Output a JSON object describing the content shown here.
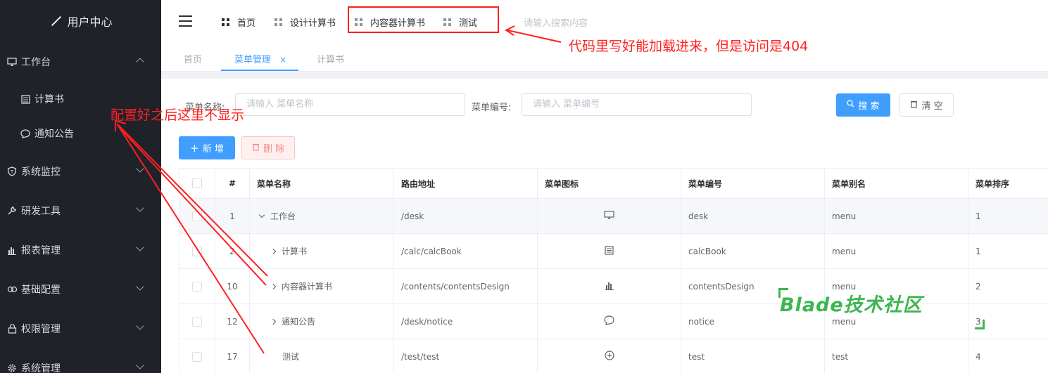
{
  "sidebar": {
    "logo": "用户中心",
    "items": [
      {
        "label": "工作台",
        "icon": "monitor-icon",
        "expanded": true
      },
      {
        "label": "计算书",
        "icon": "calculator-icon",
        "sub": true
      },
      {
        "label": "通知公告",
        "icon": "chat-bubble-icon",
        "sub": true
      },
      {
        "label": "系统监控",
        "icon": "shield-icon"
      },
      {
        "label": "研发工具",
        "icon": "wrench-icon"
      },
      {
        "label": "报表管理",
        "icon": "bar-chart-icon"
      },
      {
        "label": "基础配置",
        "icon": "link-icon"
      },
      {
        "label": "权限管理",
        "icon": "lock-icon"
      },
      {
        "label": "系统管理",
        "icon": "gear-icon"
      }
    ]
  },
  "topnav": {
    "items": [
      "首页",
      "设计计算书",
      "内容器计算书",
      "测试"
    ],
    "search_placeholder": "请输入搜索内容"
  },
  "tabs": [
    "首页",
    "菜单管理",
    "计算书"
  ],
  "tab_close": "×",
  "form": {
    "name_label": "菜单名称:",
    "name_placeholder": "请输入 菜单名称",
    "code_label": "菜单编号:",
    "code_placeholder": "请输入 菜单编号",
    "search_btn": "搜 索",
    "clear_btn": "清 空",
    "add_btn": "新 增",
    "delete_btn": "删 除"
  },
  "table": {
    "headers": [
      "#",
      "菜单名称",
      "路由地址",
      "菜单图标",
      "菜单编号",
      "菜单别名",
      "菜单排序"
    ],
    "rows": [
      {
        "id": "1",
        "name": "工作台",
        "path": "/desk",
        "icon": "monitor-icon",
        "code": "desk",
        "alias": "menu",
        "sort": "1",
        "caret": "down"
      },
      {
        "id": "2",
        "name": "计算书",
        "path": "/calc/calcBook",
        "icon": "calculator-icon",
        "code": "calcBook",
        "alias": "menu",
        "sort": "1",
        "caret": "right"
      },
      {
        "id": "10",
        "name": "内容器计算书",
        "path": "/contents/contentsDesign",
        "icon": "bar-chart-icon",
        "code": "contentsDesign",
        "alias": "menu",
        "sort": "2",
        "caret": "right"
      },
      {
        "id": "12",
        "name": "通知公告",
        "path": "/desk/notice",
        "icon": "chat-bubble-icon",
        "code": "notice",
        "alias": "menu",
        "sort": "3",
        "caret": "right"
      },
      {
        "id": "17",
        "name": "测试",
        "path": "/test/test",
        "icon": "plus-circle-icon",
        "code": "test",
        "alias": "test",
        "sort": "4",
        "caret": "none"
      }
    ]
  },
  "annotations": {
    "top": "代码里写好能加载进来，但是访问是404",
    "left": "配置好之后这里不显示",
    "watermark": "Blade技术社区"
  },
  "colors": {
    "primary": "#409eff",
    "sidebar_bg": "#20222a",
    "annotation_red": "#ff1f1f",
    "watermark_green": "#3db64f"
  }
}
